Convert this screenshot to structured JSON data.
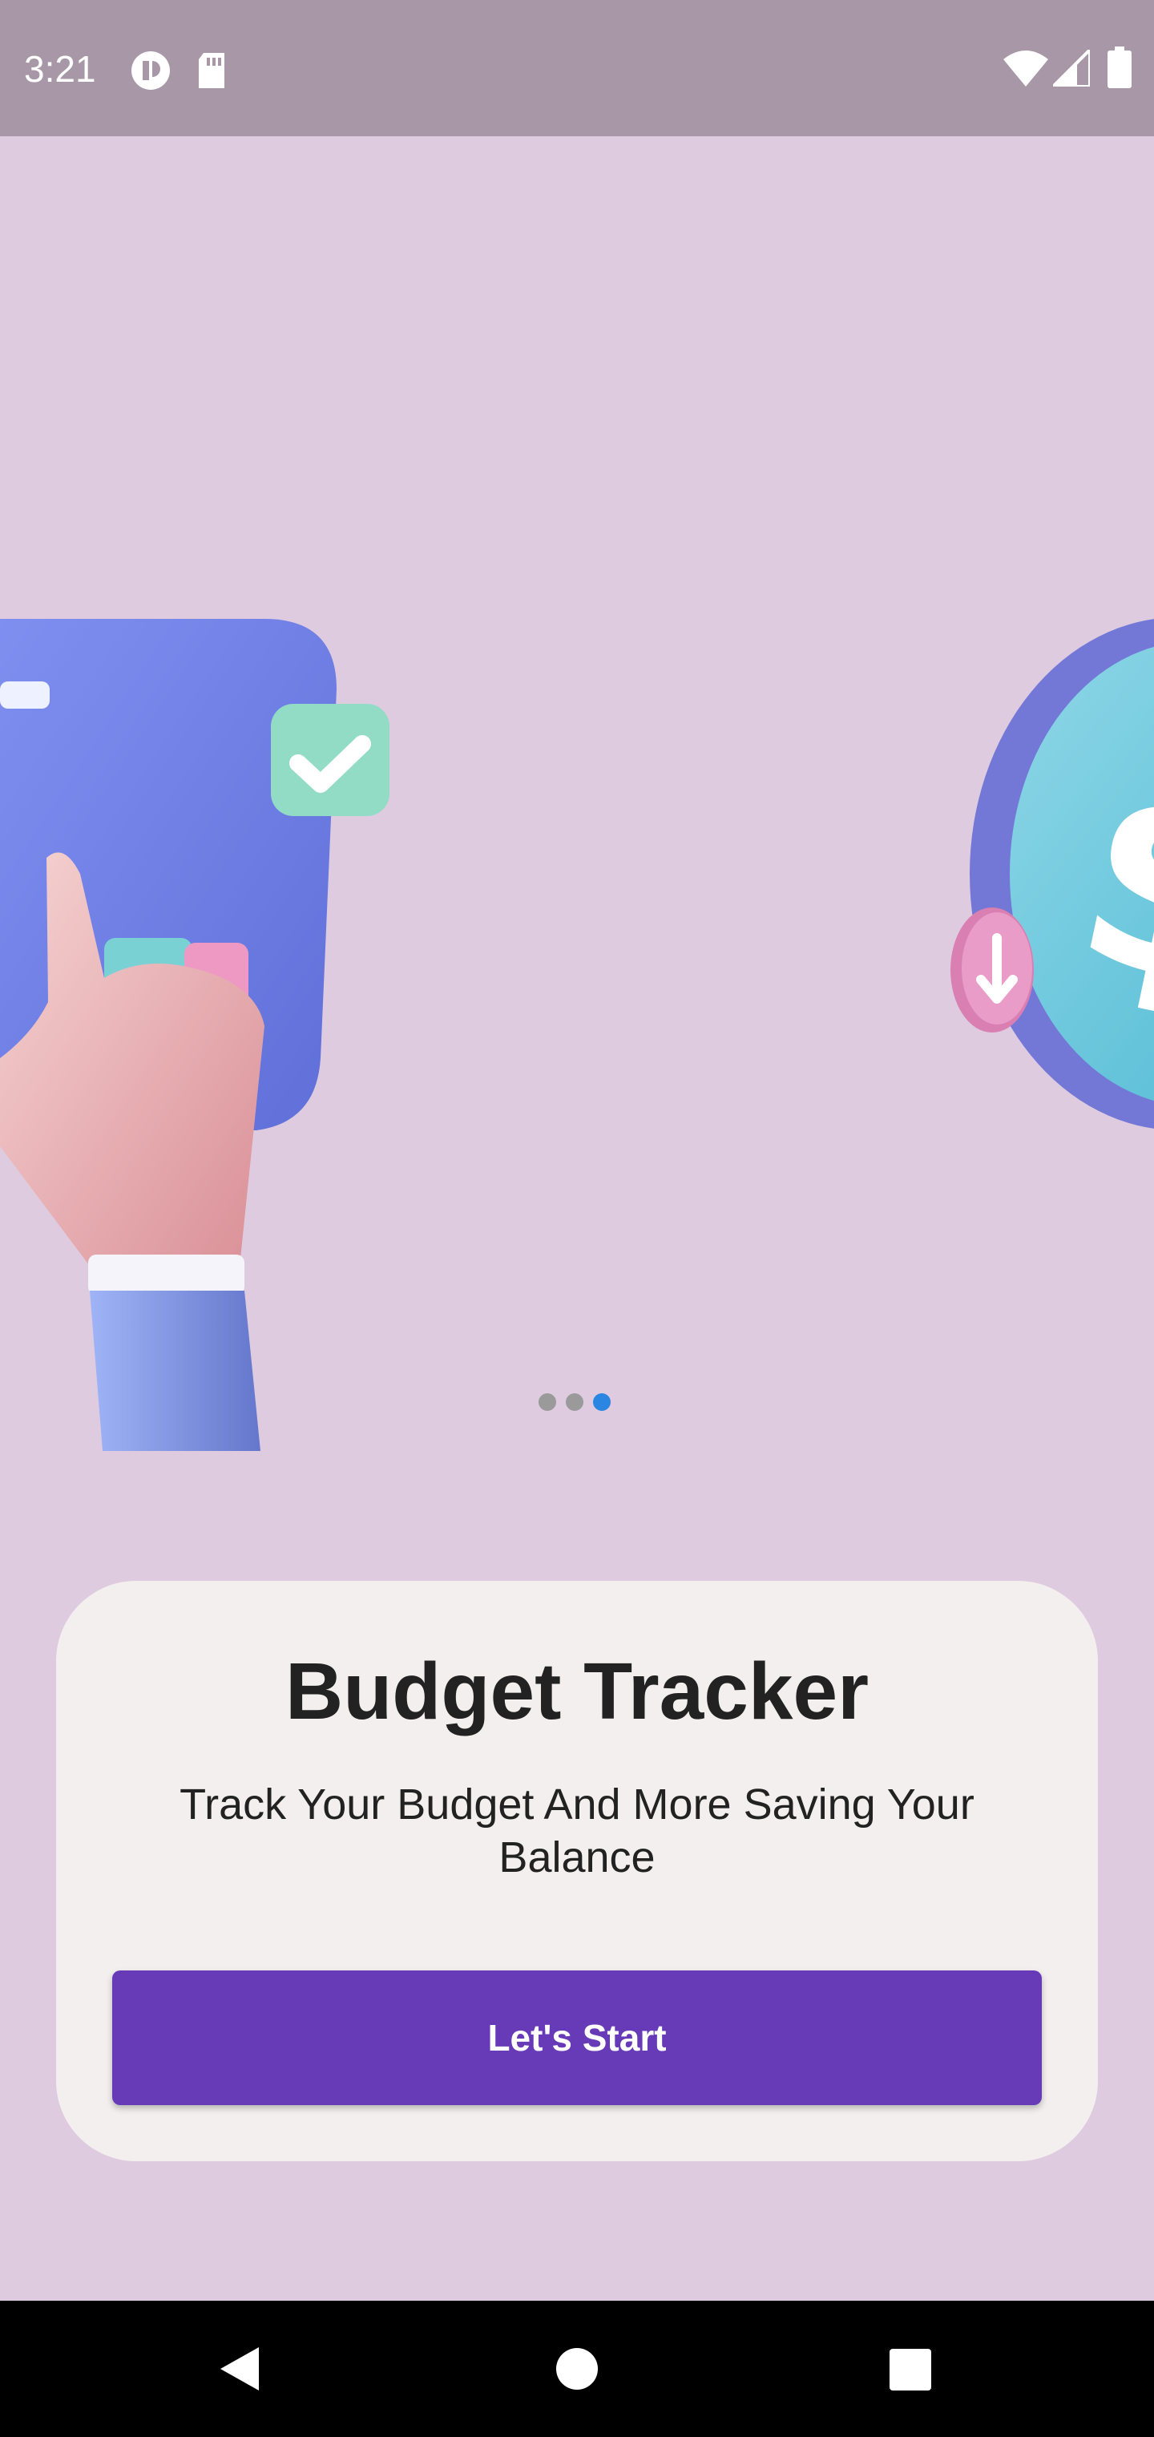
{
  "status_bar": {
    "time": "3:21",
    "left_icons": [
      "privacy-indicator-icon",
      "sd-card-icon"
    ],
    "right_icons": [
      "wifi-icon",
      "cellular-signal-icon",
      "battery-icon"
    ]
  },
  "hero": {
    "illustrations": [
      "hand-tapping-tablet-illustration",
      "dollar-coin-illustration"
    ],
    "pager": {
      "count": 3,
      "active_index": 2
    }
  },
  "card": {
    "title": "Budget Tracker",
    "subtitle": "Track Your Budget And More Saving Your Balance",
    "button_label": "Let's Start"
  },
  "nav_bar": {
    "buttons": [
      "back-icon",
      "home-icon",
      "recents-icon"
    ]
  },
  "colors": {
    "background": "#dfcbe0",
    "status_bar": "#a797a7",
    "card": "#f3efef",
    "primary": "#673ab7",
    "pager_active": "#2a86e0",
    "pager_inactive": "#9a9a9a"
  }
}
